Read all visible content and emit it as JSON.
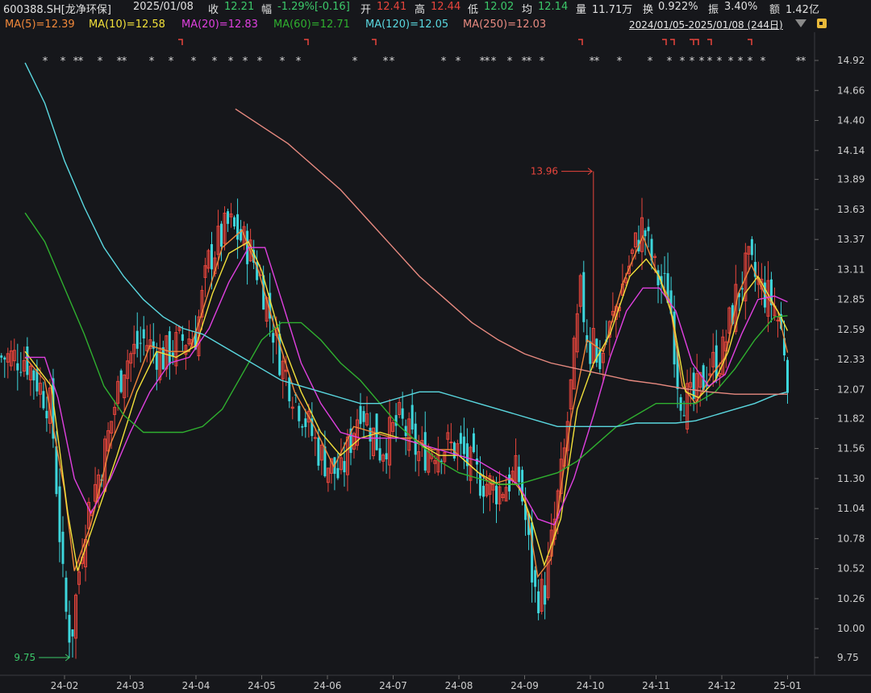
{
  "header": {
    "code_name": "600388.SH[龙净环保]",
    "date": "2025/01/08",
    "close_label": "收",
    "close_value": "12.21",
    "change_label": "幅",
    "change_value": "-1.29%[-0.16]",
    "open_label": "开",
    "open_value": "12.41",
    "high_label": "高",
    "high_value": "12.44",
    "low_label": "低",
    "low_value": "12.02",
    "avg_label": "均",
    "avg_value": "12.14",
    "volume_label": "量",
    "volume_value": "11.71万",
    "turnover_label": "换",
    "turnover_value": "0.922%",
    "amplitude_label": "振",
    "amplitude_value": "3.40%",
    "amount_label": "额",
    "amount_value": "1.42亿"
  },
  "ma_legend": [
    {
      "text": "MA(5)=12.39",
      "color": "#f0883a"
    },
    {
      "text": "MA(10)=12.58",
      "color": "#f2e03a"
    },
    {
      "text": "MA(20)=12.83",
      "color": "#e040e0"
    },
    {
      "text": "MA(60)=12.71",
      "color": "#2fb02f"
    },
    {
      "text": "MA(120)=12.05",
      "color": "#5ad8e0"
    },
    {
      "text": "MA(250)=12.03",
      "color": "#e88a80"
    }
  ],
  "range_label": "2024/01/05-2025/01/08 (244日)",
  "chart_data": {
    "type": "candlestick",
    "y_ticks": [
      14.92,
      14.66,
      14.4,
      14.14,
      13.89,
      13.63,
      13.37,
      13.11,
      12.85,
      12.59,
      12.33,
      12.07,
      11.82,
      11.56,
      11.3,
      11.04,
      10.78,
      10.52,
      10.26,
      10.0,
      9.75
    ],
    "x_ticks": [
      "24-02",
      "24-03",
      "24-04",
      "24-05",
      "24-06",
      "24-07",
      "24-08",
      "24-09",
      "24-10",
      "24-11",
      "24-12",
      "25-01"
    ],
    "annotations": [
      {
        "text": "13.96",
        "value": 13.96,
        "month_index": 8.05,
        "side": "left"
      },
      {
        "text": "9.75",
        "value": 9.75,
        "month_index": 0.1,
        "side": "left"
      }
    ],
    "close_key": [
      [
        -0.6,
        12.35
      ],
      [
        -0.2,
        11.9
      ],
      [
        0.0,
        10.2
      ],
      [
        0.1,
        9.9
      ],
      [
        0.3,
        10.9
      ],
      [
        0.6,
        11.5
      ],
      [
        0.9,
        12.3
      ],
      [
        1.2,
        12.5
      ],
      [
        1.5,
        12.35
      ],
      [
        1.8,
        12.5
      ],
      [
        2.0,
        12.55
      ],
      [
        2.2,
        13.2
      ],
      [
        2.5,
        13.5
      ],
      [
        2.8,
        13.3
      ],
      [
        3.0,
        13.0
      ],
      [
        3.3,
        12.3
      ],
      [
        3.6,
        11.9
      ],
      [
        3.9,
        11.5
      ],
      [
        4.2,
        11.3
      ],
      [
        4.5,
        11.95
      ],
      [
        4.8,
        11.55
      ],
      [
        5.1,
        11.8
      ],
      [
        5.4,
        11.5
      ],
      [
        5.7,
        11.6
      ],
      [
        6.0,
        11.55
      ],
      [
        6.3,
        11.3
      ],
      [
        6.6,
        11.2
      ],
      [
        6.9,
        11.35
      ],
      [
        7.0,
        11.0
      ],
      [
        7.15,
        10.3
      ],
      [
        7.3,
        10.3
      ],
      [
        7.6,
        11.5
      ],
      [
        7.85,
        12.9
      ],
      [
        8.05,
        12.2
      ],
      [
        8.2,
        12.4
      ],
      [
        8.5,
        13.0
      ],
      [
        8.8,
        13.5
      ],
      [
        9.0,
        13.05
      ],
      [
        9.2,
        12.9
      ],
      [
        9.35,
        12.05
      ],
      [
        9.55,
        11.95
      ],
      [
        9.8,
        12.25
      ],
      [
        10.0,
        12.35
      ],
      [
        10.2,
        12.85
      ],
      [
        10.4,
        13.15
      ],
      [
        10.6,
        12.95
      ],
      [
        10.8,
        12.8
      ],
      [
        10.95,
        12.45
      ],
      [
        11.0,
        12.21
      ]
    ],
    "ma": {
      "MA5": [
        [
          -0.6,
          12.35
        ],
        [
          -0.3,
          12.15
        ],
        [
          0.0,
          11.2
        ],
        [
          0.15,
          10.5
        ],
        [
          0.4,
          10.9
        ],
        [
          0.7,
          11.6
        ],
        [
          1.0,
          12.0
        ],
        [
          1.3,
          12.45
        ],
        [
          1.6,
          12.4
        ],
        [
          1.9,
          12.4
        ],
        [
          2.1,
          12.75
        ],
        [
          2.4,
          13.3
        ],
        [
          2.7,
          13.45
        ],
        [
          2.95,
          13.1
        ],
        [
          3.2,
          12.6
        ],
        [
          3.5,
          12.05
        ],
        [
          3.8,
          11.75
        ],
        [
          4.1,
          11.4
        ],
        [
          4.4,
          11.75
        ],
        [
          4.7,
          11.7
        ],
        [
          5.0,
          11.65
        ],
        [
          5.3,
          11.65
        ],
        [
          5.6,
          11.55
        ],
        [
          5.9,
          11.55
        ],
        [
          6.2,
          11.4
        ],
        [
          6.5,
          11.25
        ],
        [
          6.8,
          11.3
        ],
        [
          7.0,
          11.15
        ],
        [
          7.2,
          10.45
        ],
        [
          7.4,
          10.6
        ],
        [
          7.7,
          11.8
        ],
        [
          7.95,
          12.5
        ],
        [
          8.2,
          12.4
        ],
        [
          8.5,
          13.0
        ],
        [
          8.8,
          13.4
        ],
        [
          9.0,
          13.1
        ],
        [
          9.2,
          12.85
        ],
        [
          9.4,
          12.1
        ],
        [
          9.6,
          11.95
        ],
        [
          9.85,
          12.2
        ],
        [
          10.05,
          12.35
        ],
        [
          10.25,
          12.9
        ],
        [
          10.45,
          13.15
        ],
        [
          10.65,
          12.9
        ],
        [
          10.85,
          12.75
        ],
        [
          11.0,
          12.39
        ]
      ],
      "MA10": [
        [
          -0.6,
          12.4
        ],
        [
          -0.2,
          12.1
        ],
        [
          0.05,
          11.0
        ],
        [
          0.2,
          10.5
        ],
        [
          0.5,
          11.0
        ],
        [
          0.8,
          11.5
        ],
        [
          1.1,
          12.05
        ],
        [
          1.4,
          12.4
        ],
        [
          1.7,
          12.35
        ],
        [
          2.0,
          12.45
        ],
        [
          2.25,
          12.9
        ],
        [
          2.5,
          13.25
        ],
        [
          2.8,
          13.35
        ],
        [
          3.0,
          13.1
        ],
        [
          3.3,
          12.5
        ],
        [
          3.6,
          12.05
        ],
        [
          3.9,
          11.7
        ],
        [
          4.2,
          11.5
        ],
        [
          4.5,
          11.65
        ],
        [
          4.8,
          11.7
        ],
        [
          5.1,
          11.65
        ],
        [
          5.4,
          11.6
        ],
        [
          5.7,
          11.5
        ],
        [
          6.0,
          11.5
        ],
        [
          6.3,
          11.35
        ],
        [
          6.6,
          11.25
        ],
        [
          6.9,
          11.25
        ],
        [
          7.1,
          10.95
        ],
        [
          7.3,
          10.55
        ],
        [
          7.55,
          10.95
        ],
        [
          7.8,
          11.9
        ],
        [
          8.05,
          12.3
        ],
        [
          8.3,
          12.55
        ],
        [
          8.6,
          13.05
        ],
        [
          8.85,
          13.2
        ],
        [
          9.05,
          13.05
        ],
        [
          9.25,
          12.7
        ],
        [
          9.45,
          12.05
        ],
        [
          9.65,
          12.0
        ],
        [
          9.9,
          12.15
        ],
        [
          10.1,
          12.4
        ],
        [
          10.35,
          12.9
        ],
        [
          10.55,
          13.05
        ],
        [
          10.75,
          12.85
        ],
        [
          10.9,
          12.7
        ],
        [
          11.0,
          12.58
        ]
      ],
      "MA20": [
        [
          -0.6,
          12.35
        ],
        [
          -0.3,
          12.35
        ],
        [
          -0.1,
          12.0
        ],
        [
          0.15,
          11.3
        ],
        [
          0.4,
          11.0
        ],
        [
          0.7,
          11.3
        ],
        [
          1.0,
          11.7
        ],
        [
          1.3,
          12.05
        ],
        [
          1.6,
          12.3
        ],
        [
          1.9,
          12.35
        ],
        [
          2.2,
          12.6
        ],
        [
          2.5,
          13.0
        ],
        [
          2.8,
          13.3
        ],
        [
          3.05,
          13.3
        ],
        [
          3.3,
          12.85
        ],
        [
          3.6,
          12.3
        ],
        [
          3.9,
          11.95
        ],
        [
          4.2,
          11.7
        ],
        [
          4.5,
          11.65
        ],
        [
          4.8,
          11.65
        ],
        [
          5.1,
          11.65
        ],
        [
          5.4,
          11.6
        ],
        [
          5.7,
          11.55
        ],
        [
          6.0,
          11.5
        ],
        [
          6.3,
          11.45
        ],
        [
          6.6,
          11.35
        ],
        [
          6.9,
          11.25
        ],
        [
          7.2,
          10.95
        ],
        [
          7.45,
          10.9
        ],
        [
          7.75,
          11.3
        ],
        [
          8.05,
          11.85
        ],
        [
          8.3,
          12.35
        ],
        [
          8.55,
          12.75
        ],
        [
          8.8,
          12.95
        ],
        [
          9.05,
          12.95
        ],
        [
          9.3,
          12.75
        ],
        [
          9.55,
          12.3
        ],
        [
          9.8,
          12.1
        ],
        [
          10.05,
          12.2
        ],
        [
          10.3,
          12.55
        ],
        [
          10.55,
          12.85
        ],
        [
          10.8,
          12.88
        ],
        [
          11.0,
          12.83
        ]
      ],
      "MA60": [
        [
          -0.6,
          13.6
        ],
        [
          -0.3,
          13.35
        ],
        [
          0.0,
          12.95
        ],
        [
          0.3,
          12.55
        ],
        [
          0.6,
          12.1
        ],
        [
          0.9,
          11.85
        ],
        [
          1.2,
          11.7
        ],
        [
          1.5,
          11.7
        ],
        [
          1.8,
          11.7
        ],
        [
          2.1,
          11.75
        ],
        [
          2.4,
          11.9
        ],
        [
          2.7,
          12.2
        ],
        [
          3.0,
          12.5
        ],
        [
          3.3,
          12.65
        ],
        [
          3.6,
          12.65
        ],
        [
          3.9,
          12.5
        ],
        [
          4.2,
          12.3
        ],
        [
          4.5,
          12.15
        ],
        [
          4.8,
          11.95
        ],
        [
          5.1,
          11.75
        ],
        [
          5.4,
          11.6
        ],
        [
          5.7,
          11.45
        ],
        [
          6.0,
          11.35
        ],
        [
          6.3,
          11.3
        ],
        [
          6.6,
          11.25
        ],
        [
          6.9,
          11.25
        ],
        [
          7.2,
          11.3
        ],
        [
          7.5,
          11.35
        ],
        [
          7.8,
          11.45
        ],
        [
          8.1,
          11.6
        ],
        [
          8.4,
          11.75
        ],
        [
          8.7,
          11.85
        ],
        [
          9.0,
          11.95
        ],
        [
          9.3,
          11.95
        ],
        [
          9.6,
          11.95
        ],
        [
          9.9,
          12.05
        ],
        [
          10.2,
          12.25
        ],
        [
          10.5,
          12.5
        ],
        [
          10.8,
          12.7
        ],
        [
          11.0,
          12.71
        ]
      ],
      "MA120": [
        [
          -0.6,
          14.9
        ],
        [
          -0.3,
          14.55
        ],
        [
          0.0,
          14.05
        ],
        [
          0.3,
          13.65
        ],
        [
          0.6,
          13.3
        ],
        [
          0.9,
          13.05
        ],
        [
          1.2,
          12.85
        ],
        [
          1.5,
          12.7
        ],
        [
          1.8,
          12.6
        ],
        [
          2.1,
          12.55
        ],
        [
          2.4,
          12.45
        ],
        [
          2.7,
          12.35
        ],
        [
          3.0,
          12.25
        ],
        [
          3.3,
          12.15
        ],
        [
          3.6,
          12.1
        ],
        [
          3.9,
          12.05
        ],
        [
          4.2,
          12.0
        ],
        [
          4.5,
          11.95
        ],
        [
          4.8,
          11.95
        ],
        [
          5.1,
          12.0
        ],
        [
          5.4,
          12.05
        ],
        [
          5.7,
          12.05
        ],
        [
          6.0,
          12.0
        ],
        [
          6.3,
          11.95
        ],
        [
          6.6,
          11.9
        ],
        [
          6.9,
          11.85
        ],
        [
          7.2,
          11.8
        ],
        [
          7.5,
          11.75
        ],
        [
          7.8,
          11.75
        ],
        [
          8.1,
          11.75
        ],
        [
          8.4,
          11.75
        ],
        [
          8.7,
          11.78
        ],
        [
          9.0,
          11.78
        ],
        [
          9.3,
          11.78
        ],
        [
          9.6,
          11.8
        ],
        [
          9.9,
          11.85
        ],
        [
          10.2,
          11.9
        ],
        [
          10.5,
          11.95
        ],
        [
          10.8,
          12.02
        ],
        [
          11.0,
          12.05
        ]
      ],
      "MA250": [
        [
          2.6,
          14.5
        ],
        [
          3.0,
          14.35
        ],
        [
          3.4,
          14.2
        ],
        [
          3.8,
          14.0
        ],
        [
          4.2,
          13.8
        ],
        [
          4.6,
          13.55
        ],
        [
          5.0,
          13.3
        ],
        [
          5.4,
          13.05
        ],
        [
          5.8,
          12.85
        ],
        [
          6.2,
          12.65
        ],
        [
          6.6,
          12.5
        ],
        [
          7.0,
          12.38
        ],
        [
          7.4,
          12.3
        ],
        [
          7.8,
          12.25
        ],
        [
          8.2,
          12.2
        ],
        [
          8.6,
          12.15
        ],
        [
          9.0,
          12.12
        ],
        [
          9.4,
          12.08
        ],
        [
          9.8,
          12.05
        ],
        [
          10.2,
          12.03
        ],
        [
          10.6,
          12.03
        ],
        [
          11.0,
          12.03
        ]
      ]
    }
  }
}
